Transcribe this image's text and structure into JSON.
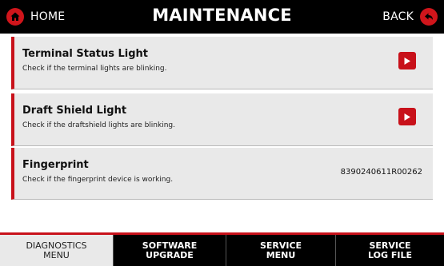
{
  "header": {
    "home_label": "HOME",
    "title": "MAINTENANCE",
    "back_label": "BACK",
    "home_icon": "home-icon",
    "back_icon": "back-arrow-icon"
  },
  "items": [
    {
      "title": "Terminal Status Light",
      "description": "Check if the terminal lights are blinking.",
      "action_icon": "play-icon"
    },
    {
      "title": "Draft Shield Light",
      "description": "Check if the draftshield lights are blinking.",
      "action_icon": "play-icon"
    },
    {
      "title": "Fingerprint",
      "description": "Check if the fingerprint device is working.",
      "value": "8390240611R00262"
    }
  ],
  "tabs": [
    {
      "label": "DIAGNOSTICS\nMENU",
      "active": true
    },
    {
      "label": "SOFTWARE\nUPGRADE",
      "active": false
    },
    {
      "label": "SERVICE\nMENU",
      "active": false
    },
    {
      "label": "SERVICE\nLOG FILE",
      "active": false
    }
  ],
  "colors": {
    "accent": "#c8111a",
    "header_bg": "#000000",
    "row_bg": "#e9e9e9"
  }
}
